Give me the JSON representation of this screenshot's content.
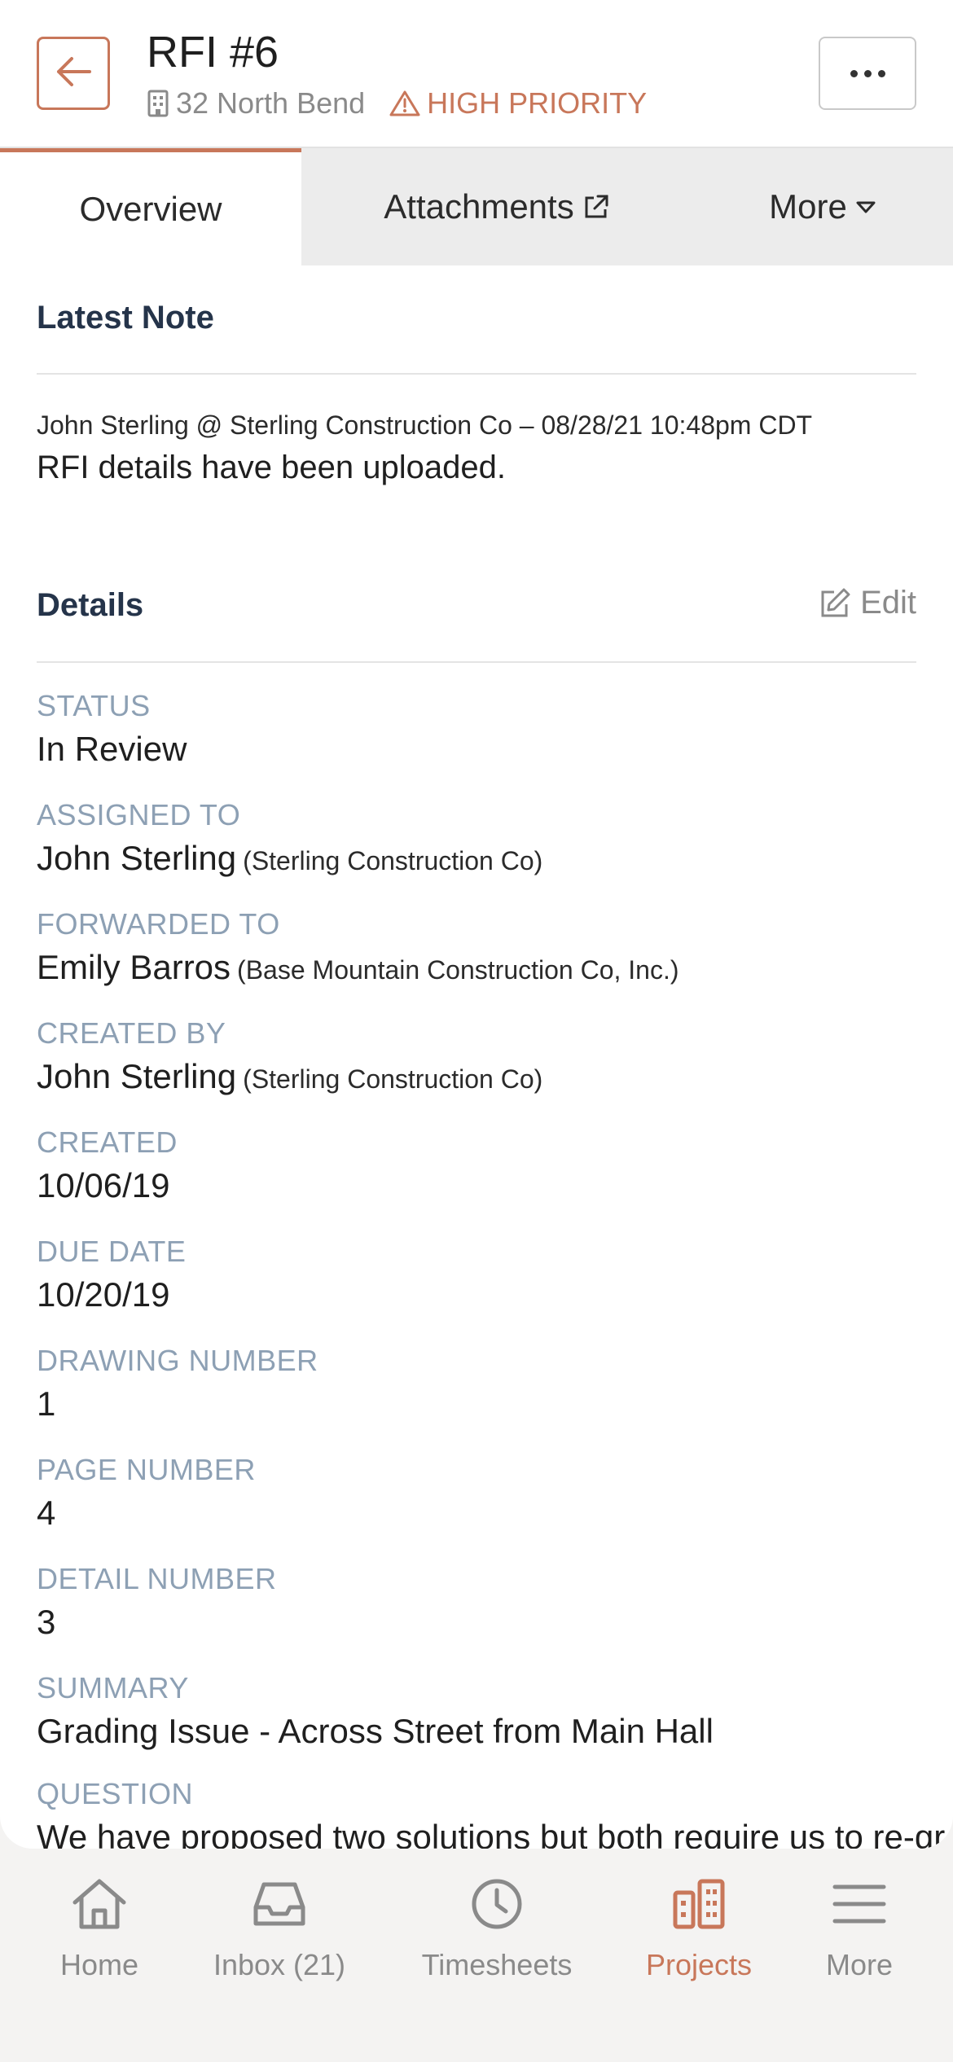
{
  "header": {
    "title": "RFI #6",
    "project": "32 North Bend",
    "priority": "HIGH PRIORITY"
  },
  "tabs": [
    {
      "label": "Overview",
      "active": true
    },
    {
      "label": "Attachments"
    },
    {
      "label": "More"
    }
  ],
  "latest_note": {
    "heading": "Latest Note",
    "meta": "John Sterling @ Sterling Construction Co – 08/28/21 10:48pm CDT",
    "text": "RFI details have been uploaded."
  },
  "details": {
    "heading": "Details",
    "edit_label": "Edit",
    "fields": [
      {
        "label": "STATUS",
        "value": "In Review",
        "company": ""
      },
      {
        "label": "ASSIGNED TO",
        "value": "John Sterling",
        "company": "(Sterling Construction Co)"
      },
      {
        "label": "FORWARDED TO",
        "value": "Emily Barros",
        "company": "(Base Mountain Construction Co, Inc.)"
      },
      {
        "label": "CREATED BY",
        "value": "John Sterling",
        "company": "(Sterling Construction Co)"
      },
      {
        "label": "CREATED",
        "value": "10/06/19",
        "company": ""
      },
      {
        "label": "DUE DATE",
        "value": "10/20/19",
        "company": ""
      },
      {
        "label": "DRAWING NUMBER",
        "value": "1",
        "company": ""
      },
      {
        "label": "PAGE NUMBER",
        "value": "4",
        "company": ""
      },
      {
        "label": "DETAIL NUMBER",
        "value": "3",
        "company": ""
      },
      {
        "label": "SUMMARY",
        "value": "Grading Issue - Across Street from Main Hall",
        "company": ""
      },
      {
        "label": "QUESTION",
        "value": "We have proposed two solutions but both require us to re-gr",
        "company": ""
      }
    ]
  },
  "bottom_nav": [
    {
      "label": "Home",
      "icon": "home-icon"
    },
    {
      "label": "Inbox (21)",
      "icon": "inbox-icon"
    },
    {
      "label": "Timesheets",
      "icon": "clock-icon"
    },
    {
      "label": "Projects",
      "icon": "buildings-icon",
      "active": true
    },
    {
      "label": "More",
      "icon": "hamburger-icon"
    }
  ],
  "colors": {
    "accent": "#c8775a",
    "label": "#8da0b4",
    "heading": "#25344a"
  }
}
